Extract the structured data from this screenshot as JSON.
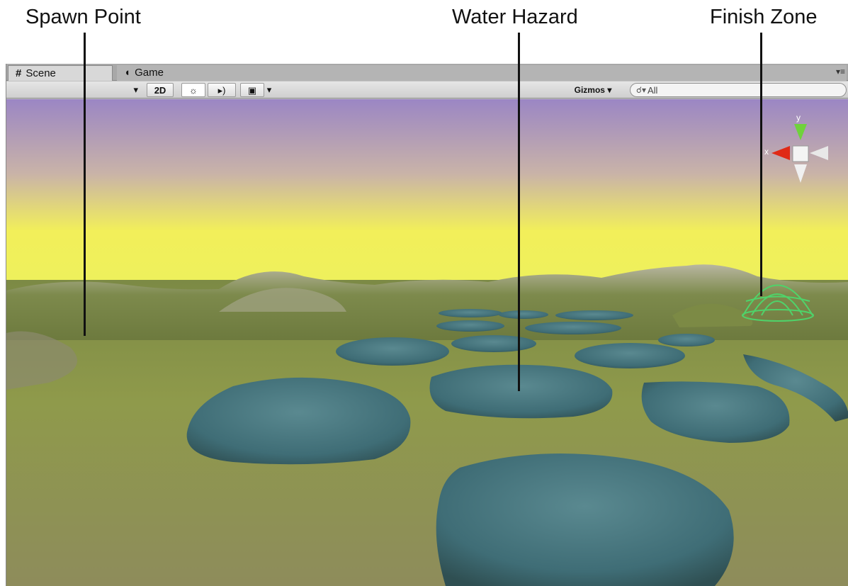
{
  "callouts": {
    "spawn": "Spawn Point",
    "water": "Water Hazard",
    "finish": "Finish Zone"
  },
  "tabs": {
    "scene": "Scene",
    "game": "Game"
  },
  "toolbar": {
    "mode_2d": "2D",
    "gizmos": "Gizmos",
    "search_value": "All"
  },
  "gizmo": {
    "axis_y": "y",
    "axis_x": "x"
  },
  "icons": {
    "scene_tab": "grid-icon",
    "game_tab": "pacman-icon",
    "lighting": "sun-icon",
    "audio": "speaker-icon",
    "effects": "image-icon",
    "search": "magnifier-icon"
  },
  "colors": {
    "sky_top": "#9c87c2",
    "sky_horizon": "#f3f25a",
    "grass": "#8f9b4a",
    "water": "#3f6f78",
    "finish_dome": "#4fd36a"
  }
}
